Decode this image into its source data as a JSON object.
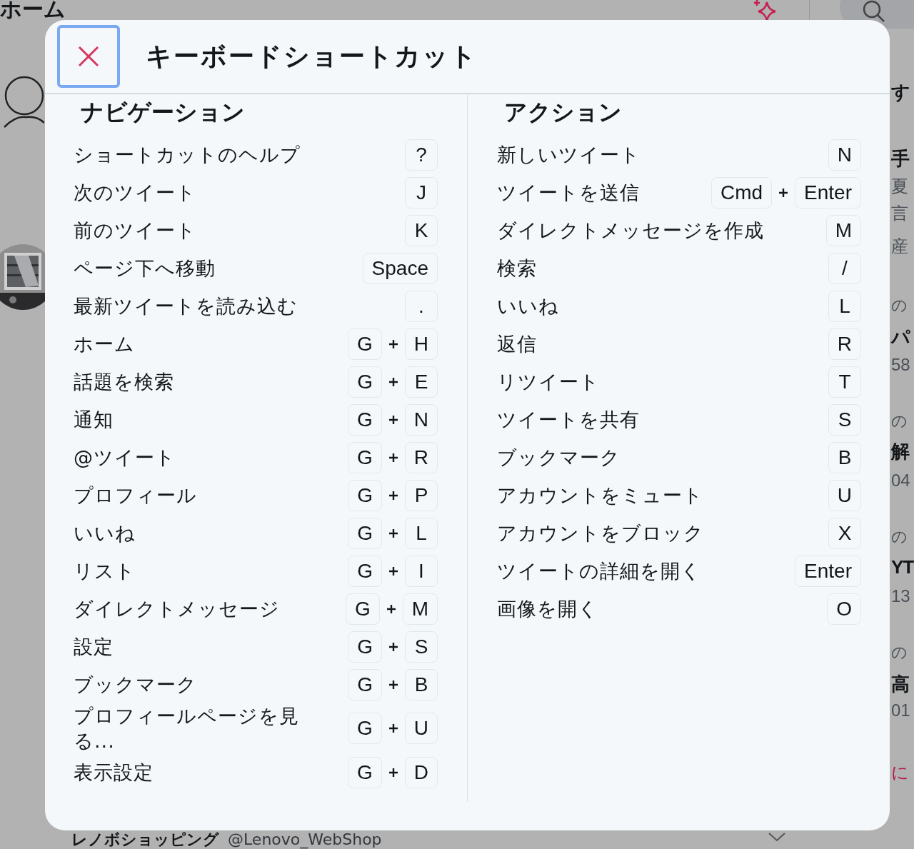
{
  "background": {
    "page_title": "ホーム",
    "side_texts": [
      {
        "kind": "bold",
        "text": "す"
      },
      {
        "kind": "bold",
        "text": "手"
      },
      {
        "kind": "meta",
        "text": "夏"
      },
      {
        "kind": "meta",
        "text": "言"
      },
      {
        "kind": "meta",
        "text": "産"
      },
      {
        "kind": "small",
        "text": "の"
      },
      {
        "kind": "bold",
        "text": "パ"
      },
      {
        "kind": "meta",
        "text": "58"
      },
      {
        "kind": "small",
        "text": "の"
      },
      {
        "kind": "bold",
        "text": "解"
      },
      {
        "kind": "meta",
        "text": "04"
      },
      {
        "kind": "small",
        "text": "の"
      },
      {
        "kind": "bold",
        "text": "YT"
      },
      {
        "kind": "meta",
        "text": "13"
      },
      {
        "kind": "small",
        "text": "の"
      },
      {
        "kind": "bold",
        "text": "高"
      },
      {
        "kind": "meta",
        "text": "01"
      },
      {
        "kind": "link",
        "text": "に"
      }
    ],
    "bottom_name": "レノボショッピング",
    "bottom_handle": "@Lenovo_WebShop"
  },
  "dialog": {
    "title": "キーボードショートカット",
    "sections": [
      {
        "heading": "ナビゲーション",
        "shortcuts": [
          {
            "label": "ショートカットのヘルプ",
            "keys": [
              "?"
            ]
          },
          {
            "label": "次のツイート",
            "keys": [
              "J"
            ]
          },
          {
            "label": "前のツイート",
            "keys": [
              "K"
            ]
          },
          {
            "label": "ページ下へ移動",
            "keys": [
              "Space"
            ]
          },
          {
            "label": "最新ツイートを読み込む",
            "keys": [
              "."
            ]
          },
          {
            "label": "ホーム",
            "keys": [
              "G",
              "H"
            ]
          },
          {
            "label": "話題を検索",
            "keys": [
              "G",
              "E"
            ]
          },
          {
            "label": "通知",
            "keys": [
              "G",
              "N"
            ]
          },
          {
            "label": "@ツイート",
            "keys": [
              "G",
              "R"
            ]
          },
          {
            "label": "プロフィール",
            "keys": [
              "G",
              "P"
            ]
          },
          {
            "label": "いいね",
            "keys": [
              "G",
              "L"
            ]
          },
          {
            "label": "リスト",
            "keys": [
              "G",
              "I"
            ]
          },
          {
            "label": "ダイレクトメッセージ",
            "keys": [
              "G",
              "M"
            ]
          },
          {
            "label": "設定",
            "keys": [
              "G",
              "S"
            ]
          },
          {
            "label": "ブックマーク",
            "keys": [
              "G",
              "B"
            ]
          },
          {
            "label": "プロフィールページを見る...",
            "keys": [
              "G",
              "U"
            ]
          },
          {
            "label": "表示設定",
            "keys": [
              "G",
              "D"
            ]
          }
        ]
      },
      {
        "heading": "アクション",
        "shortcuts": [
          {
            "label": "新しいツイート",
            "keys": [
              "N"
            ]
          },
          {
            "label": "ツイートを送信",
            "keys": [
              "Cmd",
              "Enter"
            ]
          },
          {
            "label": "ダイレクトメッセージを作成",
            "keys": [
              "M"
            ]
          },
          {
            "label": "検索",
            "keys": [
              "/"
            ]
          },
          {
            "label": "いいね",
            "keys": [
              "L"
            ]
          },
          {
            "label": "返信",
            "keys": [
              "R"
            ]
          },
          {
            "label": "リツイート",
            "keys": [
              "T"
            ]
          },
          {
            "label": "ツイートを共有",
            "keys": [
              "S"
            ]
          },
          {
            "label": "ブックマーク",
            "keys": [
              "B"
            ]
          },
          {
            "label": "アカウントをミュート",
            "keys": [
              "U"
            ]
          },
          {
            "label": "アカウントをブロック",
            "keys": [
              "X"
            ]
          },
          {
            "label": "ツイートの詳細を開く",
            "keys": [
              "Enter"
            ]
          },
          {
            "label": "画像を開く",
            "keys": [
              "O"
            ]
          }
        ]
      }
    ]
  }
}
